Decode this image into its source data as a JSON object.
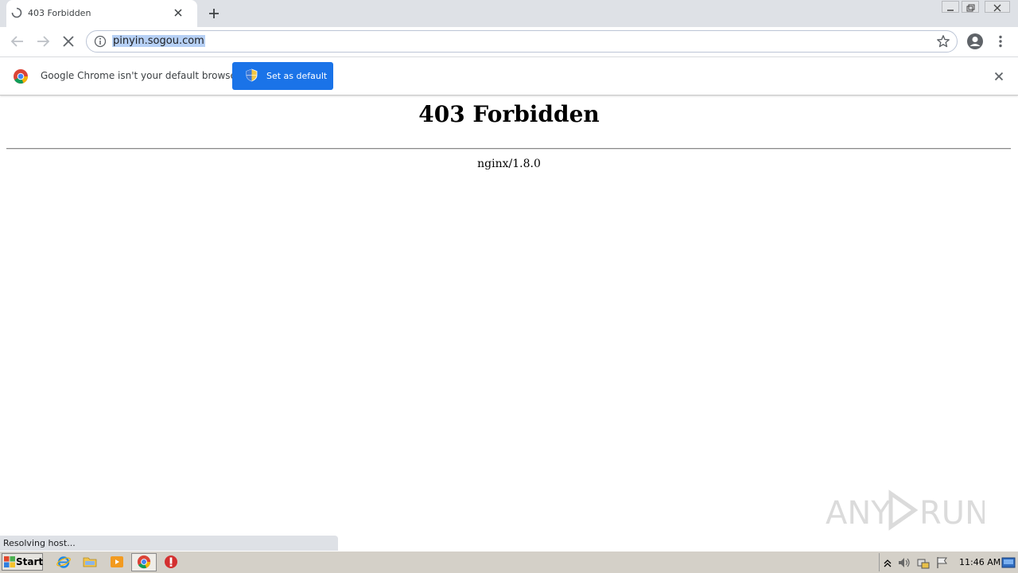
{
  "tab": {
    "title": "403 Forbidden"
  },
  "omnibox": {
    "url": "pinyin.sogou.com"
  },
  "infobar": {
    "message": "Google Chrome isn't your default browser",
    "button_label": "Set as default"
  },
  "page": {
    "heading": "403 Forbidden",
    "server": "nginx/1.8.0"
  },
  "status": {
    "text": "Resolving host..."
  },
  "watermark": {
    "text": "ANY RUN"
  },
  "taskbar": {
    "start_label": "Start",
    "clock": "11:46 AM"
  },
  "colors": {
    "accent": "#1a73e8",
    "tabstrip": "#dee1e6",
    "taskbar": "#d4d0c8"
  }
}
